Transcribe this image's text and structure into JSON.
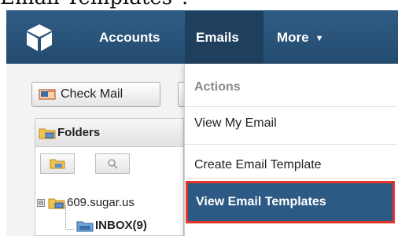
{
  "doc_heading": "Email Templates\".",
  "navbar": {
    "accounts_label": "Accounts",
    "emails_label": "Emails",
    "more_label": "More",
    "more_caret": "▼",
    "logo_icon": "cube-logo-icon"
  },
  "toolbar": {
    "check_mail_label": "Check Mail",
    "check_mail_icon": "mail-icon"
  },
  "folders": {
    "title": "Folders",
    "tabs": [
      "folder-tab-icon",
      "search-tab-icon"
    ],
    "tree": [
      {
        "label": "609.sugar.us",
        "expander": "⊟"
      },
      {
        "label": "INBOX(9)"
      }
    ]
  },
  "dropdown": {
    "section_header": "Actions",
    "items": [
      {
        "label": "View My Email"
      },
      {
        "label": "Create Email Template"
      },
      {
        "label": "View Email Templates",
        "highlighted": true
      }
    ]
  },
  "colors": {
    "navbar": "#2f5c84",
    "active_tab": "#1f3f5e",
    "highlight_bg": "#2d5a85",
    "highlight_border": "#e2352a"
  }
}
